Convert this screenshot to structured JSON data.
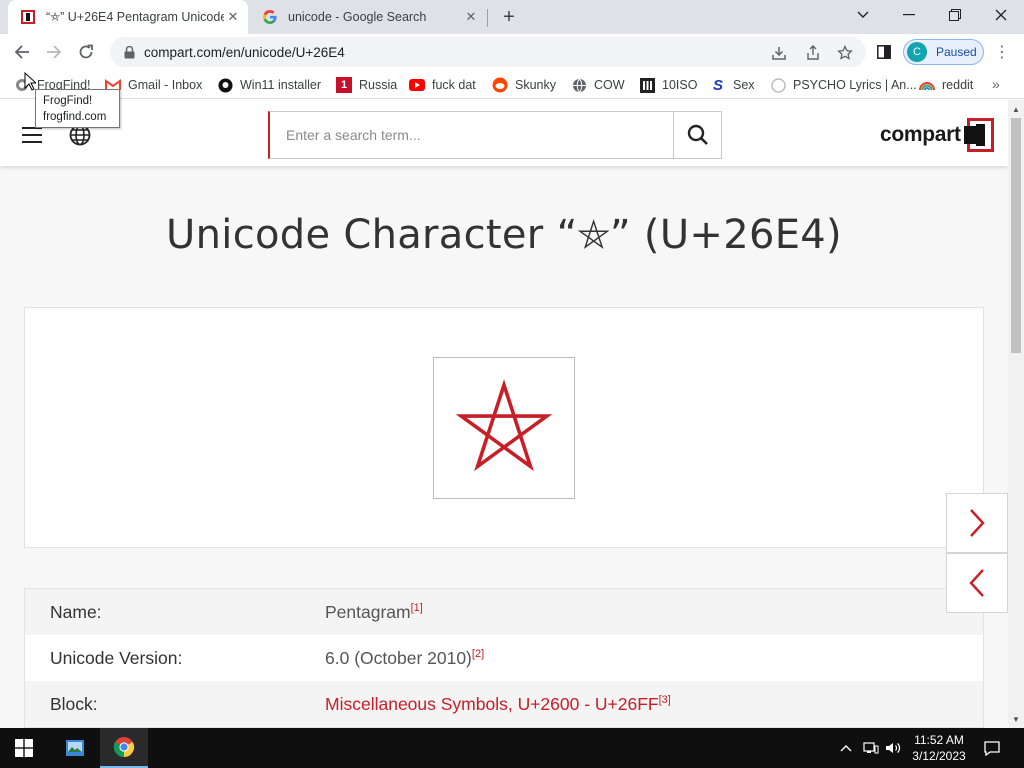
{
  "browser": {
    "tabs": [
      {
        "title": "“⛤” U+26E4 Pentagram Unicode",
        "active": true
      },
      {
        "title": "unicode - Google Search",
        "active": false
      }
    ],
    "url": "compart.com/en/unicode/U+26E4",
    "profile_initial": "C",
    "profile_label": "Paused"
  },
  "bookmarks": [
    {
      "label": "FrogFind!",
      "icon": "frogfind-icon"
    },
    {
      "label": "Gmail - Inbox",
      "icon": "gmail-icon"
    },
    {
      "label": "Win11 installer",
      "icon": "github-icon"
    },
    {
      "label": "Russia",
      "icon": "russia-bookmark-icon"
    },
    {
      "label": "fuck dat",
      "icon": "youtube-icon"
    },
    {
      "label": "Skunky",
      "icon": "reddit-icon"
    },
    {
      "label": "COW",
      "icon": "globe-icon"
    },
    {
      "label": "10ISO",
      "icon": "columns-icon"
    },
    {
      "label": "Sex",
      "icon": "s-logo-icon"
    },
    {
      "label": "PSYCHO Lyrics | An...",
      "icon": "lyrics-icon"
    },
    {
      "label": "reddit",
      "icon": "rainbow-icon"
    }
  ],
  "tooltip": {
    "line1": "FrogFind!",
    "line2": "frogfind.com"
  },
  "site": {
    "search_placeholder": "Enter a search term...",
    "logo_text": "compart",
    "page_title": "Unicode Character “⛤” (U+26E4)",
    "glyph_color": "#c81e28",
    "info": [
      {
        "key": "Name:",
        "value": "Pentagram",
        "ref": "[1]",
        "link": false
      },
      {
        "key": "Unicode Version:",
        "value": "6.0 (October 2010)",
        "ref": "[2]",
        "link": false
      },
      {
        "key": "Block:",
        "value": "Miscellaneous Symbols, U+2600 - U+26FF",
        "ref": "[3]",
        "link": true
      }
    ]
  },
  "taskbar": {
    "time": "11:52 AM",
    "date": "3/12/2023"
  }
}
